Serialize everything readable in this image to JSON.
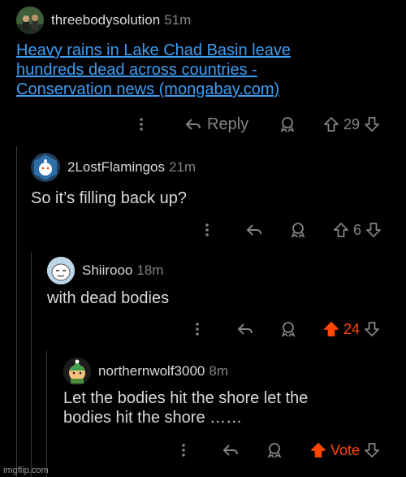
{
  "comments": [
    {
      "username": "threebodysolution",
      "time": "51m",
      "link_text": "Heavy rains in Lake Chad Basin leave hundreds dead across countries - Conservation news (mongabay.com)",
      "reply_label": "Reply",
      "score": "29",
      "vote_state": "none"
    },
    {
      "username": "2LostFlamingos",
      "time": "21m",
      "text": "So it’s filling back up?",
      "score": "6",
      "vote_state": "none"
    },
    {
      "username": "Shiirooo",
      "time": "18m",
      "text": "with dead bodies",
      "score": "24",
      "vote_state": "upvoted"
    },
    {
      "username": "northernwolf3000",
      "time": "8m",
      "text": "Let the bodies hit the shore let the bodies hit the shore ……",
      "score": "Vote",
      "vote_state": "upvoted"
    }
  ],
  "watermark": "imgflip.com",
  "colors": {
    "background": "#000000",
    "text": "#d7dadc",
    "muted": "#818384",
    "link": "#3d9df3",
    "upvote": "#ff4500"
  },
  "icons": [
    "more-vertical-icon",
    "reply-arrow-icon",
    "award-icon",
    "upvote-arrow-icon",
    "downvote-arrow-icon"
  ]
}
